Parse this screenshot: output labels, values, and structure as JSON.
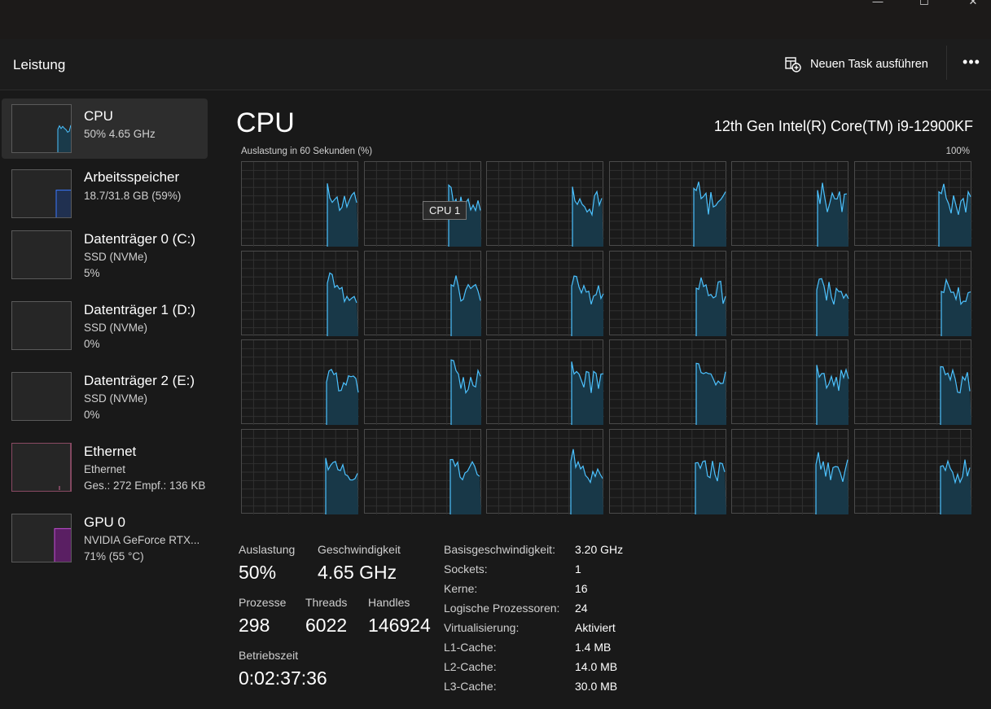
{
  "window": {
    "controls": [
      {
        "name": "minimize-button",
        "glyph": "—"
      },
      {
        "name": "maximize-button",
        "glyph": "☐"
      },
      {
        "name": "close-button",
        "glyph": "✕"
      }
    ]
  },
  "header": {
    "title": "Leistung",
    "run_task_label": "Neuen Task ausführen",
    "more_label": "•••"
  },
  "sidebar": {
    "items": [
      {
        "id": "cpu",
        "name": "CPU",
        "lines": [
          "50%  4.65 GHz"
        ],
        "color": "#4cc2ff",
        "fill": "#1a3a4a",
        "selected": true,
        "usage": 50
      },
      {
        "id": "memory",
        "name": "Arbeitsspeicher",
        "lines": [
          "18.7/31.8 GB (59%)"
        ],
        "color": "#3b78ff",
        "fill": "#203050",
        "selected": false,
        "usage": 59
      },
      {
        "id": "disk-0",
        "name": "Datenträger 0 (C:)",
        "lines": [
          "SSD (NVMe)",
          "5%"
        ],
        "color": "#9bd64c",
        "fill": "#263020",
        "selected": false,
        "usage": 5
      },
      {
        "id": "disk-1",
        "name": "Datenträger 1 (D:)",
        "lines": [
          "SSD (NVMe)",
          "0%"
        ],
        "color": "#9bd64c",
        "fill": "#263020",
        "selected": false,
        "usage": 0
      },
      {
        "id": "disk-2",
        "name": "Datenträger 2 (E:)",
        "lines": [
          "SSD (NVMe)",
          "0%"
        ],
        "color": "#9bd64c",
        "fill": "#263020",
        "selected": false,
        "usage": 0
      },
      {
        "id": "ethernet",
        "name": "Ethernet",
        "lines": [
          "Ethernet",
          "Ges.: 272 Empf.: 136 KB"
        ],
        "color": "#d06595",
        "fill": "#3a2330",
        "selected": false,
        "usage": 8
      },
      {
        "id": "gpu",
        "name": "GPU 0",
        "lines": [
          "NVIDIA GeForce RTX...",
          "71% (55 °C)"
        ],
        "color": "#c44ed6",
        "fill": "#5a1f63",
        "selected": false,
        "usage": 71
      }
    ]
  },
  "main": {
    "title": "CPU",
    "model": "12th Gen Intel(R) Core(TM) i9-12900KF",
    "graph_caption": "Auslastung in 60 Sekunden (%)",
    "graph_max": "100%",
    "tooltip": "CPU 1",
    "graph_color": "#4cc2ff",
    "graph_fill": "#183848",
    "grid_color": "#303030",
    "logical_cores": 24
  },
  "stats": {
    "auslastung": {
      "label": "Auslastung",
      "value": "50%"
    },
    "geschwindigkeit": {
      "label": "Geschwindigkeit",
      "value": "4.65 GHz"
    },
    "prozesse": {
      "label": "Prozesse",
      "value": "298"
    },
    "threads": {
      "label": "Threads",
      "value": "6022"
    },
    "handles": {
      "label": "Handles",
      "value": "146924"
    },
    "betriebszeit": {
      "label": "Betriebszeit",
      "value": "0:02:37:36"
    }
  },
  "specs": [
    {
      "label": "Basisgeschwindigkeit:",
      "value": "3.20 GHz"
    },
    {
      "label": "Sockets:",
      "value": "1"
    },
    {
      "label": "Kerne:",
      "value": "16"
    },
    {
      "label": "Logische Prozessoren:",
      "value": "24"
    },
    {
      "label": "Virtualisierung:",
      "value": "Aktiviert"
    },
    {
      "label": "L1-Cache:",
      "value": "1.4 MB"
    },
    {
      "label": "L2-Cache:",
      "value": "14.0 MB"
    },
    {
      "label": "L3-Cache:",
      "value": "30.0 MB"
    }
  ]
}
